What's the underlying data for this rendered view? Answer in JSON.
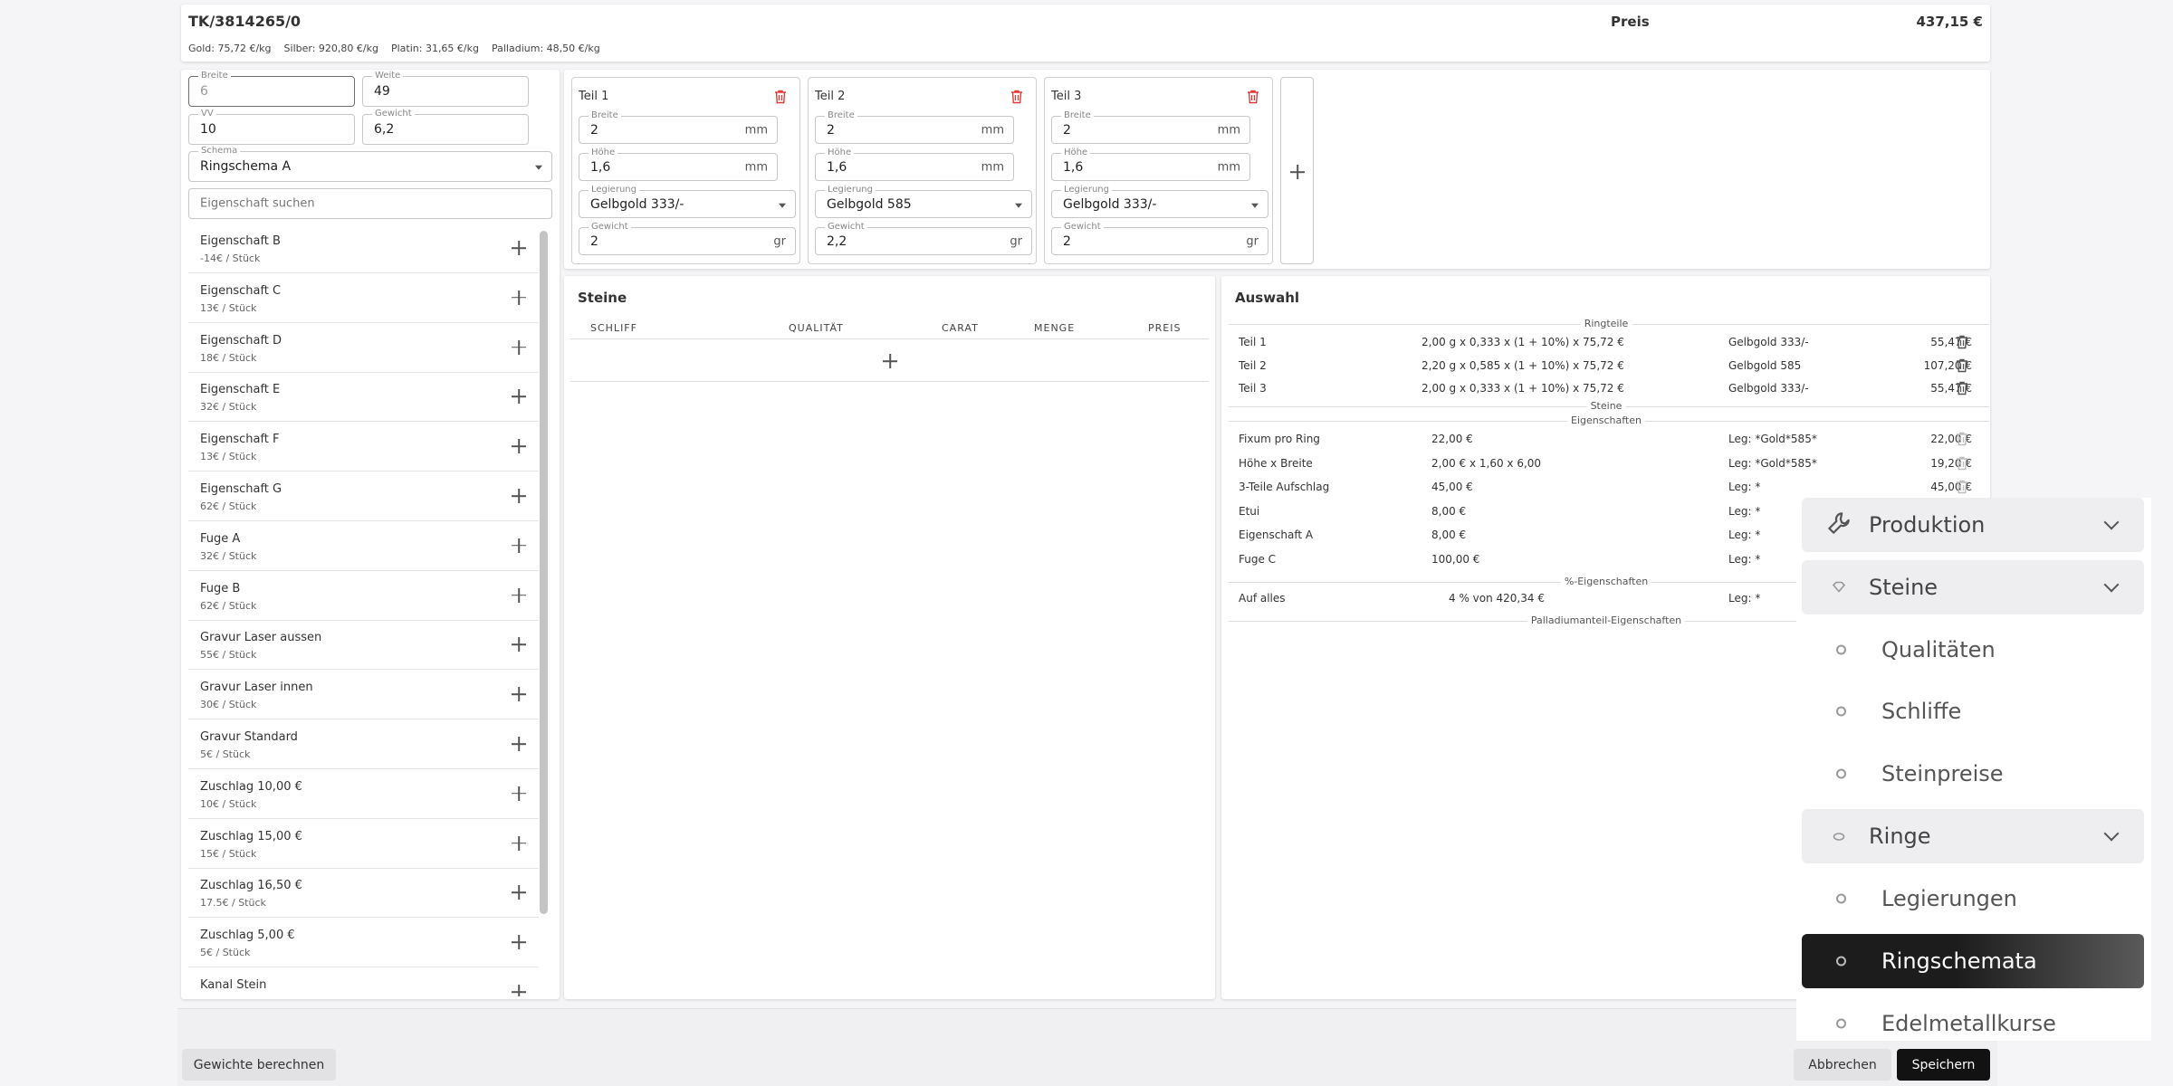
{
  "header": {
    "code": "TK/3814265/0",
    "price_label": "Preis",
    "price_value": "437,15 €",
    "metals": [
      "Gold: 75,72 €/kg",
      "Silber: 920,80 €/kg",
      "Platin: 31,65 €/kg",
      "Palladium: 48,50 €/kg"
    ]
  },
  "params": {
    "breite": {
      "label": "Breite",
      "value": "6"
    },
    "weite": {
      "label": "Weite",
      "value": "49"
    },
    "vv": {
      "label": "VV",
      "value": "10"
    },
    "gewicht": {
      "label": "Gewicht",
      "value": "6,2"
    },
    "schema": {
      "label": "Schema",
      "value": "Ringschema A"
    },
    "search_placeholder": "Eigenschaft suchen"
  },
  "properties": [
    {
      "name": "Eigenschaft B",
      "price": "-14€ / Stück"
    },
    {
      "name": "Eigenschaft C",
      "price": "13€ / Stück"
    },
    {
      "name": "Eigenschaft D",
      "price": "18€ / Stück"
    },
    {
      "name": "Eigenschaft E",
      "price": "32€ / Stück"
    },
    {
      "name": "Eigenschaft F",
      "price": "13€ / Stück"
    },
    {
      "name": "Eigenschaft G",
      "price": "62€ / Stück"
    },
    {
      "name": "Fuge A",
      "price": "32€ / Stück"
    },
    {
      "name": "Fuge B",
      "price": "62€ / Stück"
    },
    {
      "name": "Gravur Laser aussen",
      "price": "55€ / Stück"
    },
    {
      "name": "Gravur Laser innen",
      "price": "30€ / Stück"
    },
    {
      "name": "Gravur Standard",
      "price": "5€ / Stück"
    },
    {
      "name": "Zuschlag 10,00 €",
      "price": "10€ / Stück"
    },
    {
      "name": "Zuschlag 15,00 €",
      "price": "15€ / Stück"
    },
    {
      "name": "Zuschlag 16,50 €",
      "price": "17.5€ / Stück"
    },
    {
      "name": "Zuschlag 5,00 €",
      "price": "5€ / Stück"
    },
    {
      "name": "Kanal Stein",
      "price": ""
    }
  ],
  "parts": [
    {
      "title": "Teil 1",
      "breite": "2",
      "hoehe": "1,6",
      "legierung": "Gelbgold 333/-",
      "gewicht": "2"
    },
    {
      "title": "Teil 2",
      "breite": "2",
      "hoehe": "1,6",
      "legierung": "Gelbgold 585",
      "gewicht": "2,2"
    },
    {
      "title": "Teil 3",
      "breite": "2",
      "hoehe": "1,6",
      "legierung": "Gelbgold 333/-",
      "gewicht": "2"
    }
  ],
  "part_labels": {
    "breite": "Breite",
    "hoehe": "Höhe",
    "legierung": "Legierung",
    "gewicht": "Gewicht",
    "mm": "mm",
    "gr": "gr"
  },
  "steine": {
    "title": "Steine",
    "columns": [
      "SCHLIFF",
      "QUALITÄT",
      "CARAT",
      "MENGE",
      "PREIS"
    ]
  },
  "auswahl": {
    "title": "Auswahl",
    "section_ringteile": "Ringteile",
    "section_steine": "Steine",
    "section_eigenschaften": "Eigenschaften",
    "section_pct": "%-Eigenschaften",
    "section_palladium": "Palladiumanteil-Eigenschaften",
    "ringteile": [
      {
        "name": "Teil 1",
        "formula": "2,00 g x 0,333 x (1 + 10%) x 75,72 €",
        "alloy": "Gelbgold 333/-",
        "price": "55,47 €"
      },
      {
        "name": "Teil 2",
        "formula": "2,20 g x 0,585 x (1 + 10%) x 75,72 €",
        "alloy": "Gelbgold 585",
        "price": "107,20 €"
      },
      {
        "name": "Teil 3",
        "formula": "2,00 g x 0,333 x (1 + 10%) x 75,72 €",
        "alloy": "Gelbgold 333/-",
        "price": "55,47 €"
      }
    ],
    "eigenschaften": [
      {
        "name": "Fixum pro Ring",
        "value": "22,00 €",
        "leg": "Leg: *Gold*585*",
        "price": "22,00 €"
      },
      {
        "name": "Höhe x Breite",
        "value": "2,00 € x 1,60 x 6,00",
        "leg": "Leg: *Gold*585*",
        "price": "19,20 €"
      },
      {
        "name": "3-Teile Aufschlag",
        "value": "45,00 €",
        "leg": "Leg: *",
        "price": "45,00 €"
      },
      {
        "name": "Etui",
        "value": "8,00 €",
        "leg": "Leg: *",
        "price": ""
      },
      {
        "name": "Eigenschaft A",
        "value": "8,00 €",
        "leg": "Leg: *",
        "price": ""
      },
      {
        "name": "Fuge C",
        "value": "100,00 €",
        "leg": "Leg: *",
        "price": ""
      }
    ],
    "pct": [
      {
        "name": "Auf alles",
        "value": "4 % von 420,34 €",
        "leg": "Leg: *"
      }
    ]
  },
  "footer": {
    "calc": "Gewichte berechnen",
    "cancel": "Abbrechen",
    "save": "Speichern"
  },
  "menu": {
    "items": [
      {
        "label": "Produktion",
        "type": "parent",
        "icon": "wrench-icon"
      },
      {
        "label": "Steine",
        "type": "parent",
        "icon": "gem-icon"
      },
      {
        "label": "Qualitäten",
        "type": "child"
      },
      {
        "label": "Schliffe",
        "type": "child"
      },
      {
        "label": "Steinpreise",
        "type": "child"
      },
      {
        "label": "Ringe",
        "type": "parent",
        "icon": "ring-icon"
      },
      {
        "label": "Legierungen",
        "type": "child"
      },
      {
        "label": "Ringschemata",
        "type": "active"
      },
      {
        "label": "Edelmetallkurse",
        "type": "child"
      }
    ]
  },
  "colors": {
    "delete": "#e53935",
    "active_menu": "#1c1c1c",
    "menu_bg": "#eeeef0"
  }
}
